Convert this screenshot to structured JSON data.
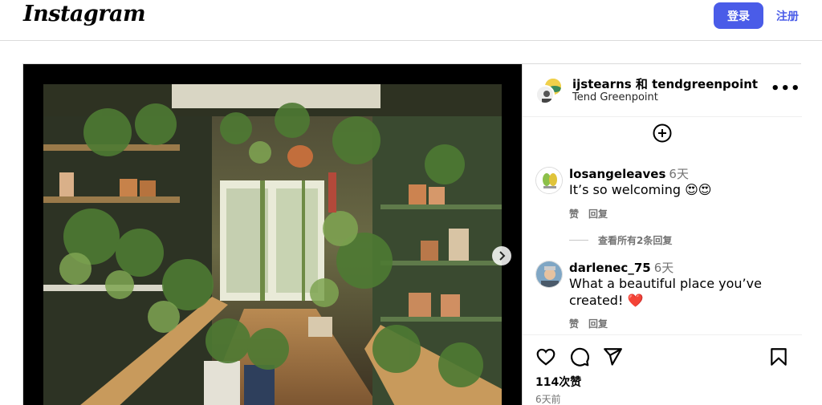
{
  "header": {
    "logo": "Instagram",
    "login_label": "登录",
    "signup_label": "注册"
  },
  "post": {
    "author_line": "ijstearns 和 tendgreenpoint",
    "subtitle": "Tend Greenpoint",
    "more_label": "•••",
    "comments": [
      {
        "user": "losangeleaves",
        "time": "6天",
        "text": "It’s so welcoming 😍😍",
        "like_label": "赞",
        "reply_label": "回复"
      },
      {
        "user": "darlenec_75",
        "time": "6天",
        "text": "What a beautiful place you’ve created! ❤️",
        "like_label": "赞",
        "reply_label": "回复"
      }
    ],
    "view_all_replies": "查看所有2条回复",
    "likes": "114次赞",
    "date": "6天前"
  },
  "colors": {
    "accent": "#4a5ce8",
    "border": "#dbdbdb",
    "muted_text": "#737373"
  },
  "icons": [
    "add-circle-icon",
    "heart-icon",
    "comment-icon",
    "share-icon",
    "bookmark-icon",
    "chevron-right-icon",
    "more-icon"
  ]
}
